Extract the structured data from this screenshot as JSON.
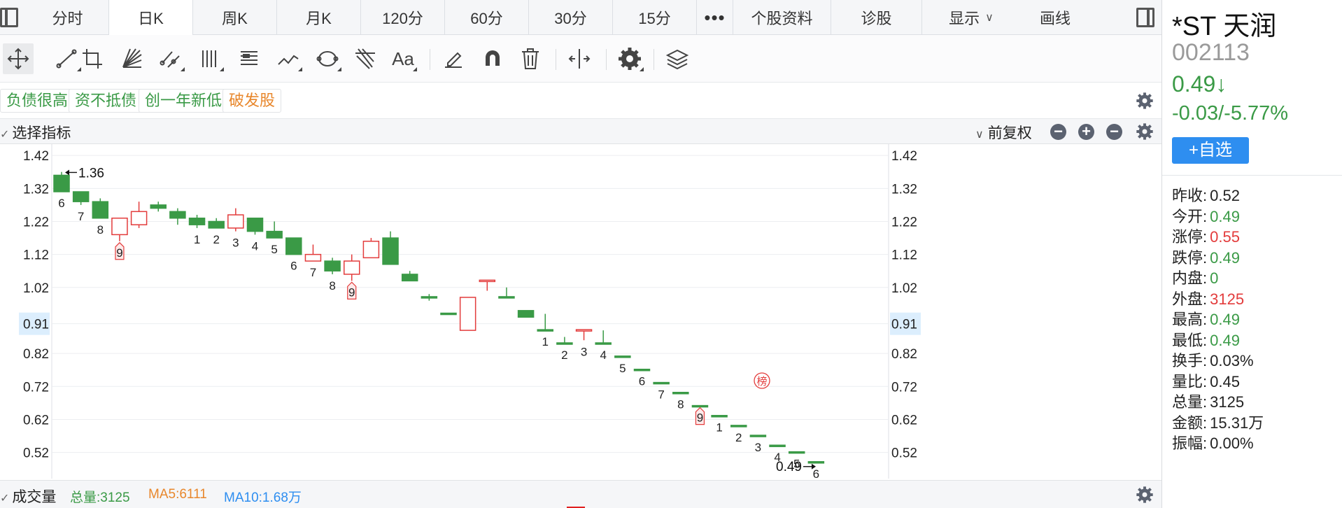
{
  "tabs": [
    {
      "label": "分时",
      "width": 118
    },
    {
      "label": "日K",
      "width": 120,
      "active": true
    },
    {
      "label": "周K",
      "width": 120
    },
    {
      "label": "月K",
      "width": 120
    },
    {
      "label": "120分",
      "width": 120
    },
    {
      "label": "60分",
      "width": 120
    },
    {
      "label": "30分",
      "width": 120
    },
    {
      "label": "15分",
      "width": 120
    }
  ],
  "tabs_more": "•••",
  "tabs_right": [
    {
      "label": "个股资料",
      "width": 140
    },
    {
      "label": "诊股",
      "width": 130
    }
  ],
  "display_menu": "显示",
  "draw_menu": "画线",
  "tool_text_label": "Aa",
  "tags": [
    {
      "label": "负债很高",
      "color": "green"
    },
    {
      "label": "资不抵债",
      "color": "green"
    },
    {
      "label": "创一年新低",
      "color": "green"
    },
    {
      "label": "破发股",
      "color": "orange"
    }
  ],
  "indicator": {
    "label": "选择指标",
    "adjust": "前复权"
  },
  "stock": {
    "name": "*ST 天润",
    "code": "002113",
    "price": "0.49↓",
    "change": "-0.03/-5.77%",
    "watch_label": "+自选"
  },
  "stats": [
    {
      "label": "昨收:",
      "value": "0.52",
      "color": "black"
    },
    {
      "label": "今开:",
      "value": "0.49",
      "color": "green"
    },
    {
      "label": "涨停:",
      "value": "0.55",
      "color": "red"
    },
    {
      "label": "跌停:",
      "value": "0.49",
      "color": "green"
    },
    {
      "label": "内盘:",
      "value": "0",
      "color": "green"
    },
    {
      "label": "外盘:",
      "value": "3125",
      "color": "red"
    },
    {
      "label": "最高:",
      "value": "0.49",
      "color": "green"
    },
    {
      "label": "最低:",
      "value": "0.49",
      "color": "green"
    },
    {
      "label": "换手:",
      "value": "0.03%",
      "color": "black"
    },
    {
      "label": "量比:",
      "value": "0.45",
      "color": "black"
    },
    {
      "label": "总量:",
      "value": "3125",
      "color": "black"
    },
    {
      "label": "金额:",
      "value": "15.31万",
      "color": "black"
    },
    {
      "label": "振幅:",
      "value": "0.00%",
      "color": "black"
    }
  ],
  "volume": {
    "label": "成交量",
    "total": "总量:3125",
    "ma5": "MA5:6111",
    "ma10": "MA10:1.68万"
  },
  "colors": {
    "up": "#e33c3c",
    "down": "#3a9a46",
    "accent": "#2e8ef0",
    "ma5": "#e8872c",
    "ma10": "#2e8ef0"
  },
  "chart_data": {
    "type": "candlestick",
    "y_ticks": [
      "1.42",
      "1.32",
      "1.22",
      "1.12",
      "1.02",
      "0.91",
      "0.82",
      "0.72",
      "0.62",
      "0.52"
    ],
    "ylim": [
      0.445,
      1.45
    ],
    "current_price": "0.91",
    "max_label": "1.36",
    "min_label": "0.49",
    "candles": [
      {
        "o": 1.31,
        "c": 1.36,
        "h": 1.37,
        "l": 1.31,
        "dir": "down",
        "tag": "6"
      },
      {
        "o": 1.28,
        "c": 1.31,
        "h": 1.31,
        "l": 1.27,
        "dir": "down",
        "tag": "7"
      },
      {
        "o": 1.23,
        "c": 1.28,
        "h": 1.29,
        "l": 1.23,
        "dir": "down",
        "tag": "8"
      },
      {
        "o": 1.18,
        "c": 1.23,
        "h": 1.23,
        "l": 1.16,
        "dir": "up",
        "tag": "9",
        "sig": true
      },
      {
        "o": 1.21,
        "c": 1.25,
        "h": 1.28,
        "l": 1.2,
        "dir": "up"
      },
      {
        "o": 1.26,
        "c": 1.27,
        "h": 1.28,
        "l": 1.25,
        "dir": "down"
      },
      {
        "o": 1.23,
        "c": 1.25,
        "h": 1.26,
        "l": 1.21,
        "dir": "down"
      },
      {
        "o": 1.21,
        "c": 1.23,
        "h": 1.24,
        "l": 1.2,
        "dir": "down",
        "tag": "1"
      },
      {
        "o": 1.2,
        "c": 1.22,
        "h": 1.23,
        "l": 1.2,
        "dir": "down",
        "tag": "2"
      },
      {
        "o": 1.2,
        "c": 1.24,
        "h": 1.26,
        "l": 1.19,
        "dir": "up",
        "tag": "3"
      },
      {
        "o": 1.19,
        "c": 1.23,
        "h": 1.23,
        "l": 1.18,
        "dir": "down",
        "tag": "4"
      },
      {
        "o": 1.17,
        "c": 1.19,
        "h": 1.22,
        "l": 1.17,
        "dir": "down",
        "tag": "5"
      },
      {
        "o": 1.12,
        "c": 1.17,
        "h": 1.17,
        "l": 1.12,
        "dir": "down",
        "tag": "6"
      },
      {
        "o": 1.1,
        "c": 1.12,
        "h": 1.15,
        "l": 1.1,
        "dir": "up",
        "tag": "7"
      },
      {
        "o": 1.07,
        "c": 1.1,
        "h": 1.11,
        "l": 1.06,
        "dir": "down",
        "tag": "8"
      },
      {
        "o": 1.06,
        "c": 1.1,
        "h": 1.12,
        "l": 1.04,
        "dir": "up",
        "tag": "9",
        "sig": true
      },
      {
        "o": 1.11,
        "c": 1.16,
        "h": 1.17,
        "l": 1.11,
        "dir": "up"
      },
      {
        "o": 1.09,
        "c": 1.17,
        "h": 1.19,
        "l": 1.09,
        "dir": "down"
      },
      {
        "o": 1.04,
        "c": 1.06,
        "h": 1.07,
        "l": 1.04,
        "dir": "down"
      },
      {
        "o": 0.99,
        "c": 0.99,
        "h": 1.0,
        "l": 0.98,
        "dir": "down"
      },
      {
        "o": 0.94,
        "c": 0.94,
        "h": 0.94,
        "l": 0.94,
        "dir": "down"
      },
      {
        "o": 0.89,
        "c": 0.99,
        "h": 0.99,
        "l": 0.89,
        "dir": "up"
      },
      {
        "o": 1.04,
        "c": 1.04,
        "h": 1.04,
        "l": 1.01,
        "dir": "up"
      },
      {
        "o": 0.99,
        "c": 0.99,
        "h": 1.02,
        "l": 0.99,
        "dir": "down"
      },
      {
        "o": 0.93,
        "c": 0.95,
        "h": 0.95,
        "l": 0.93,
        "dir": "down"
      },
      {
        "o": 0.89,
        "c": 0.89,
        "h": 0.94,
        "l": 0.89,
        "dir": "down",
        "tag": "1"
      },
      {
        "o": 0.85,
        "c": 0.85,
        "h": 0.87,
        "l": 0.85,
        "dir": "down",
        "tag": "2"
      },
      {
        "o": 0.89,
        "c": 0.89,
        "h": 0.89,
        "l": 0.86,
        "dir": "up",
        "tag": "3"
      },
      {
        "o": 0.85,
        "c": 0.85,
        "h": 0.89,
        "l": 0.85,
        "dir": "down",
        "tag": "4"
      },
      {
        "o": 0.81,
        "c": 0.81,
        "h": 0.81,
        "l": 0.81,
        "dir": "down",
        "tag": "5"
      },
      {
        "o": 0.77,
        "c": 0.77,
        "h": 0.77,
        "l": 0.77,
        "dir": "down",
        "tag": "6"
      },
      {
        "o": 0.73,
        "c": 0.73,
        "h": 0.73,
        "l": 0.73,
        "dir": "down",
        "tag": "7"
      },
      {
        "o": 0.7,
        "c": 0.7,
        "h": 0.7,
        "l": 0.7,
        "dir": "down",
        "tag": "8"
      },
      {
        "o": 0.66,
        "c": 0.66,
        "h": 0.66,
        "l": 0.66,
        "dir": "down",
        "tag": "9",
        "sig": true
      },
      {
        "o": 0.63,
        "c": 0.63,
        "h": 0.63,
        "l": 0.63,
        "dir": "down",
        "tag": "1"
      },
      {
        "o": 0.6,
        "c": 0.6,
        "h": 0.6,
        "l": 0.6,
        "dir": "down",
        "tag": "2"
      },
      {
        "o": 0.57,
        "c": 0.57,
        "h": 0.57,
        "l": 0.57,
        "dir": "down",
        "tag": "3"
      },
      {
        "o": 0.54,
        "c": 0.54,
        "h": 0.54,
        "l": 0.54,
        "dir": "down",
        "tag": "4"
      },
      {
        "o": 0.52,
        "c": 0.52,
        "h": 0.52,
        "l": 0.52,
        "dir": "down",
        "tag": "5"
      },
      {
        "o": 0.49,
        "c": 0.49,
        "h": 0.49,
        "l": 0.49,
        "dir": "down",
        "tag": "6"
      }
    ],
    "badge": "榜"
  }
}
